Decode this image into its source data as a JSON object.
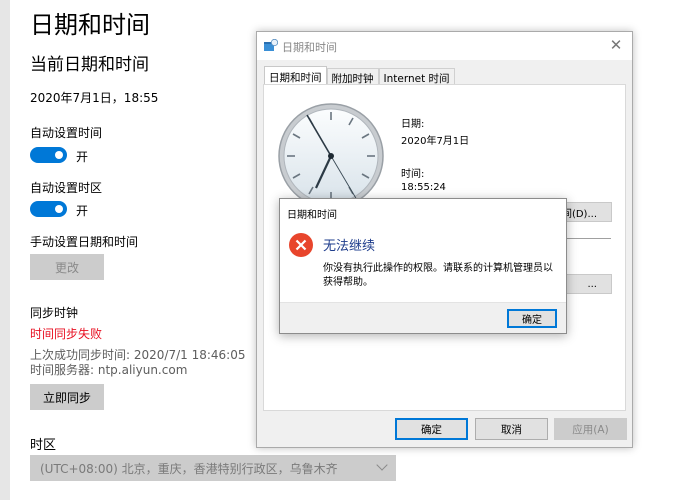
{
  "settings": {
    "title": "日期和时间",
    "subtitle": "当前日期和时间",
    "current_datetime": "2020年7月1日，18:55",
    "auto_time": {
      "label": "自动设置时间",
      "state_text": "开",
      "on": true
    },
    "auto_timezone": {
      "label": "自动设置时区",
      "state_text": "开",
      "on": true
    },
    "manual": {
      "label": "手动设置日期和时间",
      "button_label": "更改"
    },
    "sync": {
      "heading": "同步时钟",
      "error_text": "时间同步失败",
      "last_sync": "上次成功同步时间: 2020/7/1 18:46:05",
      "server": "时间服务器: ntp.aliyun.com",
      "button_label": "立即同步"
    },
    "timezone": {
      "label": "时区",
      "selected": "(UTC+08:00) 北京，重庆，香港特别行政区，乌鲁木齐"
    }
  },
  "datetime_dialog": {
    "title": "日期和时间",
    "close_icon": "close-icon",
    "tabs": [
      {
        "label": "日期和时间",
        "active": true
      },
      {
        "label": "附加时钟",
        "active": false
      },
      {
        "label": "Internet 时间",
        "active": false
      }
    ],
    "date_label": "日期:",
    "date_value": "2020年7月1日",
    "time_label": "时间:",
    "time_value": "18:55:24",
    "change_datetime_button": "间(D)...",
    "change_timezone_button": "...",
    "buttons": {
      "ok": "确定",
      "cancel": "取消",
      "apply": "应用(A)"
    }
  },
  "error_dialog": {
    "title": "日期和时间",
    "icon": "error-icon",
    "heading": "无法继续",
    "message": "你没有执行此操作的权限。请联系的计算机管理员以获得帮助。",
    "ok_label": "确定"
  },
  "colors": {
    "accent": "#0078d7",
    "error": "#e81123",
    "error_heading": "#1e3c8c"
  }
}
